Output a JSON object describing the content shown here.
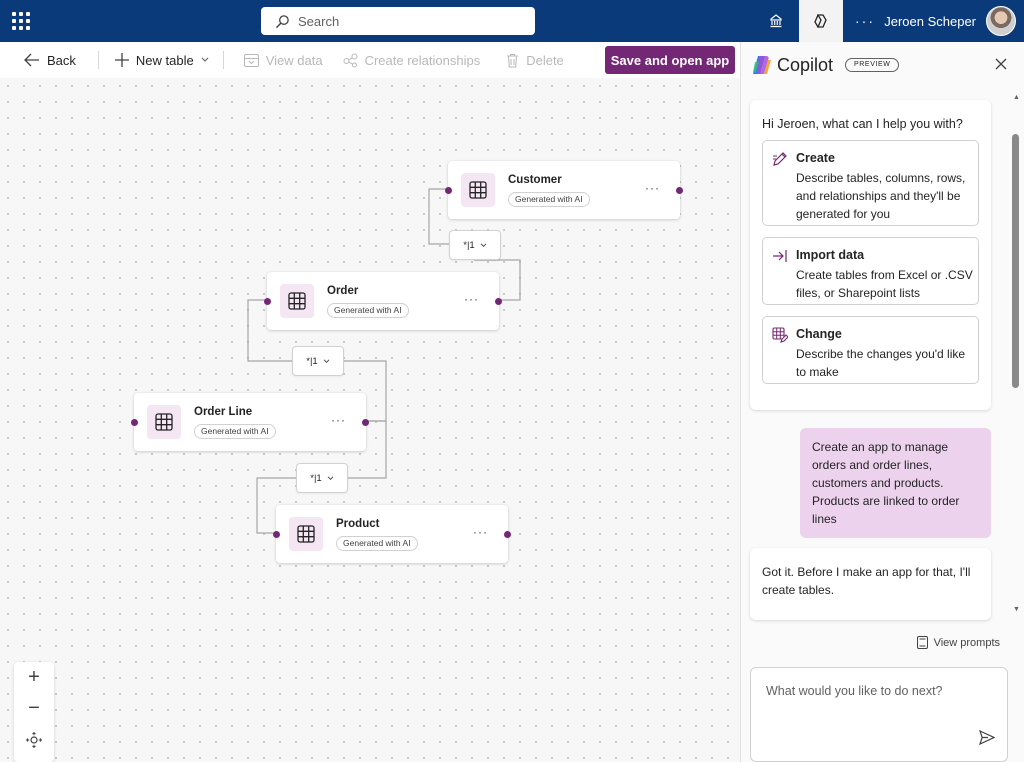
{
  "topbar": {
    "search_placeholder": "Search",
    "user_name": "Jeroen Scheper",
    "more_label": "···"
  },
  "commandbar": {
    "back": "Back",
    "new_table": "New table",
    "view_data": "View data",
    "create_relationships": "Create relationships",
    "delete": "Delete",
    "save_open": "Save and open app"
  },
  "canvas": {
    "tables": [
      {
        "name": "Customer",
        "badge": "Generated with AI",
        "more": "···"
      },
      {
        "name": "Order",
        "badge": "Generated with AI",
        "more": "···"
      },
      {
        "name": "Order Line",
        "badge": "Generated with AI",
        "more": "···"
      },
      {
        "name": "Product",
        "badge": "Generated with AI",
        "more": "···"
      }
    ],
    "relationships": [
      {
        "label": "*|1"
      },
      {
        "label": "*|1"
      },
      {
        "label": "*|1"
      }
    ],
    "zoom": {
      "in": "+",
      "out": "−"
    }
  },
  "copilot": {
    "title": "Copilot",
    "badge": "PREVIEW",
    "greeting": "Hi Jeroen, what can I help you with?",
    "options": [
      {
        "title": "Create",
        "desc": "Describe tables, columns, rows, and relationships and they'll be generated for you"
      },
      {
        "title": "Import data",
        "desc": "Create tables from Excel or .CSV files, or Sharepoint lists"
      },
      {
        "title": "Change",
        "desc": "Describe the changes you'd like to make"
      }
    ],
    "user_message": "Create an app to manage orders and order lines, customers and products. Products are linked to order lines",
    "bot_message": "Got it. Before I make an app for that, I'll create tables.",
    "view_prompts": "View prompts",
    "input_placeholder": "What would you like to do next?"
  },
  "colors": {
    "brand_bar": "#0b3a7a",
    "accent": "#742774",
    "user_bubble": "#ecd2ec",
    "table_icon_bg": "#f4e6f3"
  }
}
